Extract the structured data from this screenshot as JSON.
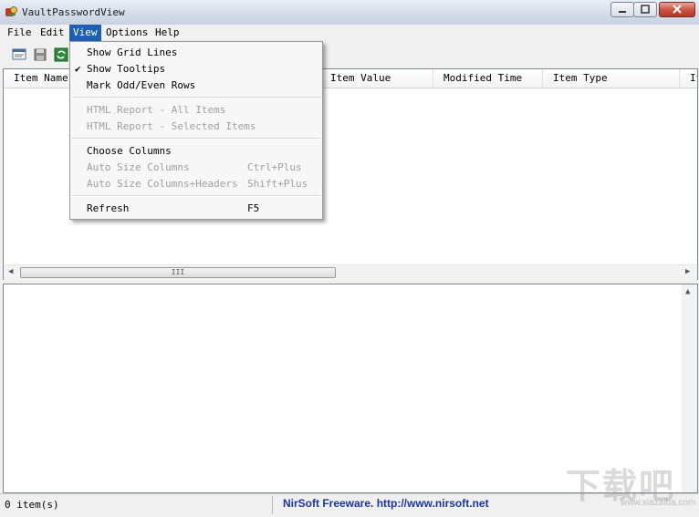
{
  "window": {
    "title": "VaultPasswordView"
  },
  "menubar": {
    "items": [
      {
        "label": "File"
      },
      {
        "label": "Edit"
      },
      {
        "label": "View"
      },
      {
        "label": "Options"
      },
      {
        "label": "Help"
      }
    ]
  },
  "toolbar": {
    "buttons": [
      {
        "icon": "properties-icon"
      },
      {
        "icon": "save-icon"
      },
      {
        "icon": "refresh-icon"
      }
    ]
  },
  "list": {
    "columns": [
      "Item Name",
      "Item Value",
      "Modified Time",
      "Item Type",
      "It"
    ],
    "scrollbar_grip": "III"
  },
  "view_menu": {
    "items": [
      {
        "label": "Show Grid Lines",
        "checked": false,
        "enabled": true,
        "shortcut": ""
      },
      {
        "label": "Show Tooltips",
        "checked": true,
        "enabled": true,
        "shortcut": ""
      },
      {
        "label": "Mark Odd/Even Rows",
        "checked": false,
        "enabled": true,
        "shortcut": ""
      },
      {
        "label": "HTML Report - All Items",
        "checked": false,
        "enabled": false,
        "shortcut": ""
      },
      {
        "label": "HTML Report - Selected Items",
        "checked": false,
        "enabled": false,
        "shortcut": ""
      },
      {
        "label": "Choose Columns",
        "checked": false,
        "enabled": true,
        "shortcut": ""
      },
      {
        "label": "Auto Size Columns",
        "checked": false,
        "enabled": false,
        "shortcut": "Ctrl+Plus"
      },
      {
        "label": "Auto Size Columns+Headers",
        "checked": false,
        "enabled": false,
        "shortcut": "Shift+Plus"
      },
      {
        "label": "Refresh",
        "checked": false,
        "enabled": true,
        "shortcut": "F5"
      }
    ],
    "check_mark": "✔"
  },
  "statusbar": {
    "count": "0 item(s)",
    "credit": "NirSoft Freeware.  http://www.nirsoft.net"
  },
  "watermark": {
    "text": "下载吧",
    "sub": "www.xiazaiba.com"
  },
  "colors": {
    "menu_highlight": "#1c5fb5",
    "credit_link": "#1c34a8"
  }
}
